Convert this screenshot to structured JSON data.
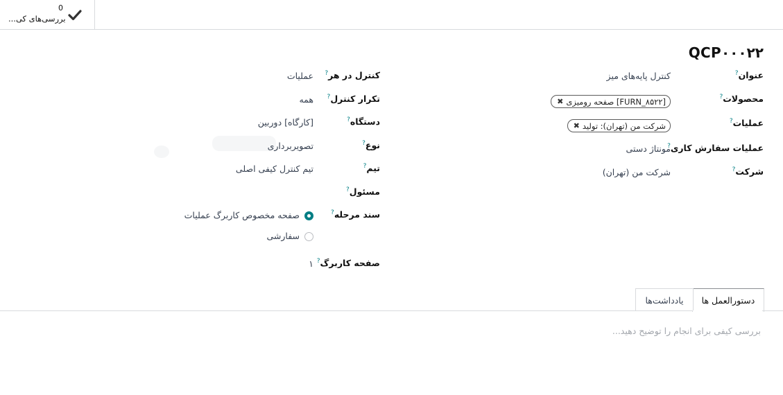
{
  "header": {
    "smart_button": {
      "count": "0",
      "label": "بررسی‌های کی...",
      "icon": "check-icon"
    }
  },
  "record": {
    "title": "QCP۰۰۰۲۲"
  },
  "left_fields": {
    "title": {
      "label": "عنوان",
      "value": "کنترل پایه‌های میز"
    },
    "products": {
      "label": "محصولات",
      "tags": [
        "[FURN_۸۵۲۲] صفحه رومیزی"
      ]
    },
    "operations": {
      "label": "عملیات",
      "tags": [
        "شرکت من (تهران): تولید"
      ]
    },
    "workorder_operation": {
      "label": "عملیات سفارش کاری",
      "value": "مونتاژ دستی"
    },
    "company": {
      "label": "شرکت",
      "value": "شرکت من (تهران)"
    }
  },
  "right_fields": {
    "control_per": {
      "label": "کنترل در هر",
      "value": "عملیات"
    },
    "control_frequency": {
      "label": "تکرار کنترل",
      "value": "همه"
    },
    "device": {
      "label": "دستگاه",
      "value": "[کارگاه] دوربین"
    },
    "type": {
      "label": "نوع",
      "value": "تصویربرداری"
    },
    "team": {
      "label": "تیم",
      "value": "تیم کنترل کیفی اصلی"
    },
    "responsible": {
      "label": "مسئول",
      "value": ""
    },
    "step_document": {
      "label": "سند مرحله",
      "options": [
        {
          "label": "صفحه مخصوص کاربرگ عملیات",
          "selected": true
        },
        {
          "label": "سفارشی",
          "selected": false
        }
      ]
    },
    "worksheet_page": {
      "label": "صفحه کاربرگ",
      "value": "۱"
    }
  },
  "tabs": [
    {
      "label": "دستورالعمل ها",
      "active": true
    },
    {
      "label": "یادداشت‌ها",
      "active": false
    }
  ],
  "instructions": {
    "placeholder": "بررسی کیفی برای انجام را توضیح دهید..."
  },
  "colors": {
    "accent": "#017e84",
    "border": "#d8dadd"
  }
}
